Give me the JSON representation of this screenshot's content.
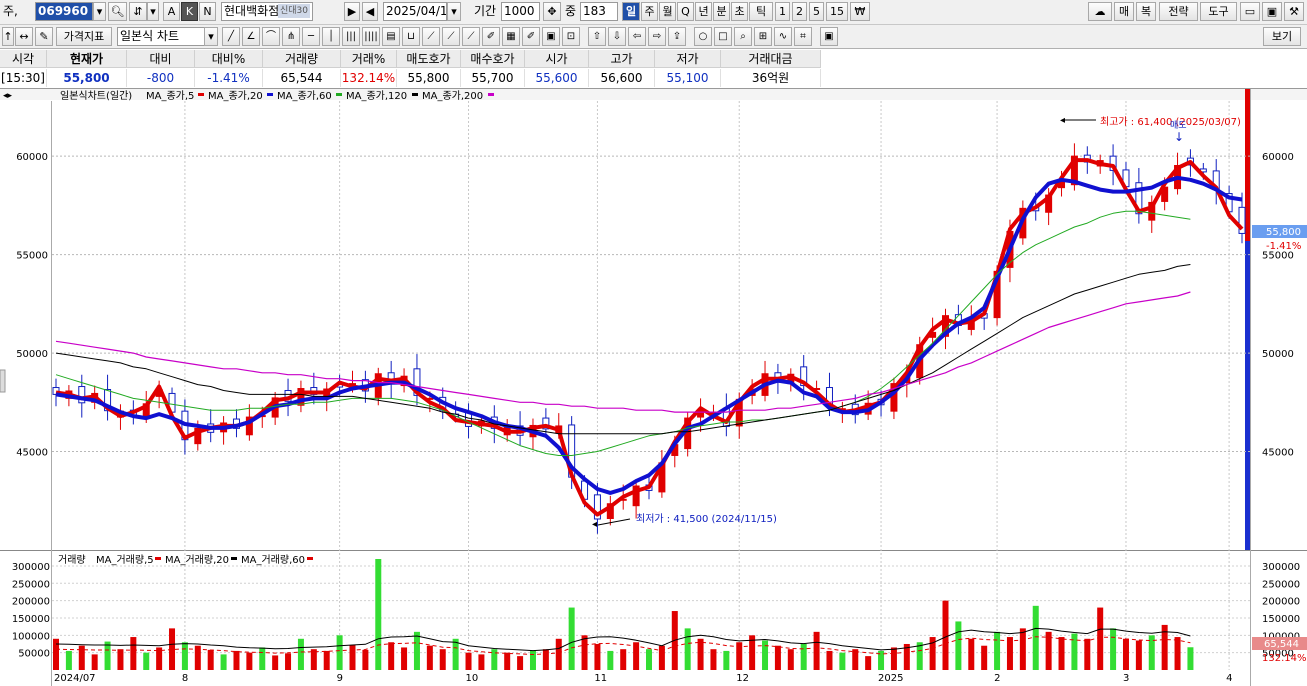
{
  "toolbar": {
    "prefix": "주,",
    "code": "069960",
    "name": "현대백화점",
    "badge": "신대30",
    "btn_a": "A",
    "btn_k": "K",
    "btn_n": "N",
    "date": "2025/04/14",
    "period_label": "기간",
    "period_value": "1000",
    "count_label": "중",
    "count_value": "183",
    "period_buttons": [
      "일",
      "주",
      "월",
      "Q",
      "년",
      "분",
      "초",
      "틱",
      "1",
      "2",
      "5",
      "15",
      "₩"
    ],
    "right_buttons": [
      "매",
      "복",
      "전략",
      "도구"
    ]
  },
  "toolbar2": {
    "indicator_button": "가격지표",
    "chart_type": "일본식 차트",
    "view_button": "보기"
  },
  "quote": {
    "headers": [
      "시각",
      "현재가",
      "대비",
      "대비%",
      "거래량",
      "거래%",
      "매도호가",
      "매수호가",
      "시가",
      "고가",
      "저가",
      "거래대금"
    ],
    "values": [
      "[15:30]",
      "55,800",
      "-800",
      "-1.41%",
      "65,544",
      "132.14%",
      "55,800",
      "55,700",
      "55,600",
      "56,600",
      "55,100",
      "36억원"
    ]
  },
  "chart_data": [
    {
      "type": "candlestick",
      "title": "일본식차트(일간)",
      "legend": [
        "MA_종가,5",
        "MA_종가,20",
        "MA_종가,60",
        "MA_종가,120",
        "MA_종가,200"
      ],
      "y_ticks": [
        45000,
        50000,
        55000,
        60000
      ],
      "ylim": [
        40000,
        62800
      ],
      "x_labels": [
        "2024/07",
        "8",
        "9",
        "10",
        "11",
        "12",
        "2025",
        "2",
        "3",
        "4"
      ],
      "current_price": "55,800",
      "current_change": "-1.41%",
      "annotations": {
        "high": "최고가 : 61,400 (2025/03/07)",
        "low": "최저가 : 41,500 (2024/11/15)",
        "signal": "매도"
      },
      "series": [
        {
          "name": "MA_종가,5",
          "color": "#e00000",
          "values": [
            48000,
            47900,
            47700,
            47800,
            47200,
            46800,
            47000,
            47300,
            48300,
            46800,
            45700,
            46000,
            46200,
            46300,
            46300,
            46500,
            47000,
            47600,
            47700,
            48000,
            48000,
            48000,
            48500,
            48300,
            48200,
            48700,
            48600,
            48700,
            48000,
            47500,
            47200,
            46600,
            46500,
            46400,
            46300,
            46000,
            46000,
            46200,
            46300,
            46100,
            43800,
            42400,
            41800,
            42200,
            42700,
            43000,
            43200,
            44300,
            45500,
            46500,
            47200,
            46800,
            46500,
            47500,
            48300,
            48700,
            48700,
            48800,
            48500,
            48000,
            47400,
            47000,
            47100,
            47300,
            47500,
            48200,
            49000,
            50300,
            51200,
            51700,
            51500,
            51600,
            52000,
            54000,
            56300,
            57100,
            57400,
            57900,
            58900,
            59800,
            59800,
            59600,
            59500,
            58300,
            57200,
            57400,
            58600,
            59400,
            59700,
            59000,
            58400,
            57000,
            56300
          ]
        },
        {
          "name": "MA_종가,20",
          "color": "#1010d0",
          "values": [
            47900,
            47800,
            47700,
            47600,
            47300,
            47000,
            46800,
            46700,
            46900,
            46700,
            46400,
            46300,
            46200,
            46200,
            46300,
            46500,
            46900,
            47300,
            47400,
            47600,
            47700,
            47700,
            48000,
            48200,
            48300,
            48400,
            48500,
            48500,
            48200,
            47900,
            47500,
            47200,
            47000,
            46800,
            46500,
            46300,
            46200,
            46000,
            45800,
            45200,
            44200,
            43600,
            43100,
            42900,
            43100,
            43500,
            43800,
            44400,
            45400,
            46200,
            46400,
            46800,
            47200,
            47600,
            48000,
            48400,
            48600,
            48500,
            48000,
            47800,
            47200,
            47000,
            47000,
            47100,
            47500,
            48000,
            48700,
            49700,
            50400,
            51000,
            51500,
            51800,
            52300,
            53800,
            55300,
            56800,
            57900,
            58600,
            58800,
            58700,
            58500,
            58300,
            58200,
            58200,
            58300,
            58400,
            58700,
            58900,
            58800,
            58600,
            58300,
            57900,
            57800
          ]
        },
        {
          "name": "MA_종가,60",
          "color": "#22aa22",
          "values": [
            48900,
            48700,
            48500,
            48300,
            48100,
            47900,
            47700,
            47600,
            47500,
            47400,
            47300,
            47200,
            47100,
            47100,
            47100,
            47200,
            47200,
            47300,
            47400,
            47400,
            47500,
            47500,
            47600,
            47700,
            47700,
            47700,
            47700,
            47600,
            47500,
            47300,
            47100,
            46800,
            46500,
            46200,
            45900,
            45600,
            45300,
            45100,
            44900,
            44800,
            44800,
            44900,
            45000,
            45200,
            45400,
            45600,
            45800,
            45900,
            46000,
            46200,
            46300,
            46400,
            46500,
            46500,
            46600,
            46600,
            46700,
            46800,
            46900,
            47000,
            47100,
            47300,
            47500,
            47800,
            48200,
            48700,
            49300,
            49900,
            50500,
            51200,
            51900,
            52600,
            53300,
            54000,
            54600,
            55100,
            55500,
            55800,
            56100,
            56400,
            56600,
            56900,
            57100,
            57200,
            57200,
            57100,
            57000,
            56900,
            56800
          ]
        },
        {
          "name": "MA_종가,120",
          "color": "#000000",
          "values": [
            50000,
            49900,
            49800,
            49700,
            49600,
            49500,
            49300,
            49200,
            49000,
            48800,
            48600,
            48400,
            48300,
            48100,
            48000,
            47900,
            47900,
            47900,
            47900,
            47900,
            47800,
            47800,
            47800,
            47800,
            47700,
            47600,
            47500,
            47400,
            47300,
            47200,
            47000,
            46900,
            46700,
            46600,
            46400,
            46300,
            46200,
            46100,
            46000,
            45900,
            45900,
            45900,
            45900,
            45900,
            45900,
            45900,
            45900,
            45900,
            46000,
            46000,
            46100,
            46200,
            46300,
            46400,
            46500,
            46600,
            46700,
            46800,
            46900,
            47000,
            47100,
            47300,
            47500,
            47700,
            47900,
            48100,
            48400,
            48700,
            49000,
            49400,
            49800,
            50200,
            50600,
            51000,
            51400,
            51800,
            52100,
            52400,
            52700,
            53000,
            53200,
            53400,
            53600,
            53800,
            54000,
            54100,
            54200,
            54400,
            54500
          ]
        },
        {
          "name": "MA_종가,200",
          "color": "#c800c8",
          "values": [
            50600,
            50500,
            50400,
            50300,
            50200,
            50100,
            50000,
            49800,
            49700,
            49600,
            49500,
            49400,
            49300,
            49200,
            49200,
            49100,
            49000,
            49000,
            48900,
            48900,
            48800,
            48700,
            48700,
            48600,
            48600,
            48500,
            48500,
            48400,
            48300,
            48200,
            48100,
            48000,
            47900,
            47800,
            47700,
            47600,
            47500,
            47500,
            47400,
            47400,
            47300,
            47300,
            47200,
            47200,
            47200,
            47100,
            47100,
            47100,
            47000,
            47000,
            47000,
            47000,
            47000,
            47100,
            47100,
            47100,
            47200,
            47200,
            47300,
            47400,
            47500,
            47600,
            47700,
            47900,
            48000,
            48200,
            48400,
            48600,
            48800,
            49000,
            49300,
            49500,
            49800,
            50100,
            50400,
            50700,
            51000,
            51300,
            51500,
            51700,
            51900,
            52100,
            52300,
            52500,
            52600,
            52700,
            52800,
            52900,
            53100
          ]
        }
      ]
    },
    {
      "type": "bar",
      "title": "거래량",
      "legend": [
        "MA_거래량,5",
        "MA_거래량,20",
        "MA_거래량,60"
      ],
      "y_ticks": [
        50000,
        100000,
        150000,
        200000,
        250000,
        300000
      ],
      "ylim": [
        0,
        320000
      ],
      "current_volume": "65,544",
      "current_ratio": "132.14%",
      "values": [
        90000,
        55000,
        70000,
        45000,
        82000,
        60000,
        95000,
        50000,
        65000,
        120000,
        80000,
        70000,
        58000,
        45000,
        55000,
        50000,
        65000,
        42000,
        48000,
        90000,
        60000,
        55000,
        100000,
        72000,
        58000,
        320000,
        80000,
        65000,
        110000,
        70000,
        60000,
        90000,
        50000,
        45000,
        60000,
        50000,
        40000,
        55000,
        60000,
        90000,
        180000,
        100000,
        75000,
        55000,
        60000,
        80000,
        60000,
        70000,
        170000,
        120000,
        90000,
        60000,
        55000,
        80000,
        100000,
        85000,
        70000,
        60000,
        75000,
        110000,
        55000,
        50000,
        60000,
        40000,
        55000,
        65000,
        75000,
        80000,
        95000,
        200000,
        140000,
        90000,
        70000,
        110000,
        95000,
        120000,
        185000,
        110000,
        95000,
        105000,
        90000,
        180000,
        120000,
        90000,
        85000,
        100000,
        130000,
        95000,
        65544
      ],
      "ma_values": [
        75000,
        74000,
        73000,
        72000,
        72000,
        71000,
        72000,
        71000,
        70000,
        74000,
        76000,
        75000,
        72000,
        70000,
        66000,
        64000,
        63000,
        61000,
        62000,
        65000,
        66000,
        67000,
        70000,
        72000,
        74000,
        90000,
        95000,
        96000,
        98000,
        90000,
        82000,
        80000,
        70000,
        66000,
        62000,
        60000,
        58000,
        56000,
        58000,
        62000,
        80000,
        90000,
        95000,
        96000,
        92000,
        86000,
        78000,
        70000,
        86000,
        96000,
        100000,
        96000,
        88000,
        84000,
        86000,
        88000,
        84000,
        78000,
        76000,
        80000,
        76000,
        70000,
        66000,
        62000,
        58000,
        60000,
        64000,
        70000,
        78000,
        95000,
        110000,
        115000,
        110000,
        108000,
        105000,
        108000,
        120000,
        118000,
        112000,
        108000,
        105000,
        118000,
        118000,
        112000,
        108000,
        106000,
        110000,
        108000,
        98000
      ]
    }
  ]
}
